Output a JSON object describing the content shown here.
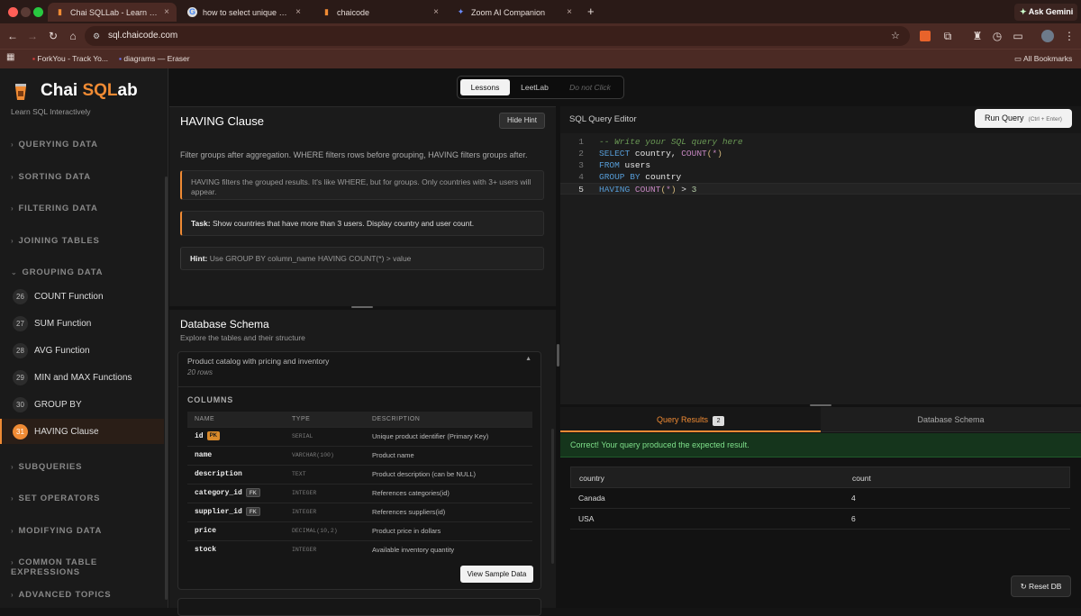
{
  "browser": {
    "tabs": [
      {
        "title": "Chai SQLLab - Learn SQL Interactively",
        "icon": "chai-cup-icon",
        "active": true
      },
      {
        "title": "how to select unique values in",
        "icon": "google-icon",
        "active": false
      },
      {
        "title": "chaicode",
        "icon": "chai-cup-icon",
        "active": false
      },
      {
        "title": "Zoom AI Companion",
        "icon": "sparkle-icon",
        "active": false
      }
    ],
    "new_tab": "+",
    "ask_gemini": "Ask Gemini",
    "url": "sql.chaicode.com",
    "bookmarks": [
      "ForkYou - Track Yo...",
      "diagrams — Eraser"
    ],
    "all_bookmarks": "All Bookmarks"
  },
  "sidebar": {
    "logo_a": "Chai ",
    "logo_b": "SQL",
    "logo_c": "ab",
    "tagline": "Learn SQL Interactively",
    "sections": [
      "QUERYING DATA",
      "SORTING DATA",
      "FILTERING DATA",
      "JOINING TABLES",
      "GROUPING DATA",
      "SUBQUERIES",
      "SET OPERATORS",
      "MODIFYING DATA",
      "COMMON TABLE EXPRESSIONS",
      "ADVANCED TOPICS"
    ],
    "lessons": [
      {
        "num": "26",
        "label": "COUNT Function"
      },
      {
        "num": "27",
        "label": "SUM Function"
      },
      {
        "num": "28",
        "label": "AVG Function"
      },
      {
        "num": "29",
        "label": "MIN and MAX Functions"
      },
      {
        "num": "30",
        "label": "GROUP BY"
      },
      {
        "num": "31",
        "label": "HAVING Clause"
      }
    ]
  },
  "mode_switch": {
    "lessons": "Lessons",
    "leetlab": "LeetLab",
    "donot": "Do not Click"
  },
  "lesson": {
    "title": "HAVING Clause",
    "hide_hint": "Hide Hint",
    "description": "Filter groups after aggregation. WHERE filters rows before grouping, HAVING filters groups after.",
    "note": "HAVING filters the grouped results. It's like WHERE, but for groups. Only countries with 3+ users will appear.",
    "task_label": "Task:",
    "task": "Show countries that have more than 3 users. Display country and user count.",
    "hint_label": "Hint:",
    "hint": "Use GROUP BY column_name HAVING COUNT(*) > value"
  },
  "schema": {
    "title": "Database Schema",
    "subtitle": "Explore the tables and their structure",
    "table_desc": "Product catalog with pricing and inventory",
    "rows": "20 rows",
    "columns_label": "COLUMNS",
    "headers": {
      "name": "NAME",
      "type": "TYPE",
      "desc": "DESCRIPTION"
    },
    "columns": [
      {
        "name": "id",
        "badge": "PK",
        "type": "SERIAL",
        "desc": "Unique product identifier (Primary Key)"
      },
      {
        "name": "name",
        "badge": "",
        "type": "VARCHAR(100)",
        "desc": "Product name"
      },
      {
        "name": "description",
        "badge": "",
        "type": "TEXT",
        "desc": "Product description (can be NULL)"
      },
      {
        "name": "category_id",
        "badge": "FK",
        "type": "INTEGER",
        "desc": "References categories(id)"
      },
      {
        "name": "supplier_id",
        "badge": "FK",
        "type": "INTEGER",
        "desc": "References suppliers(id)"
      },
      {
        "name": "price",
        "badge": "",
        "type": "DECIMAL(10,2)",
        "desc": "Product price in dollars"
      },
      {
        "name": "stock",
        "badge": "",
        "type": "INTEGER",
        "desc": "Available inventory quantity"
      }
    ],
    "view_sample": "View Sample Data"
  },
  "editor": {
    "title": "SQL Query Editor",
    "run": "Run Query",
    "shortcut": "(Ctrl + Enter)",
    "lines": [
      {
        "num": "1",
        "tokens": [
          [
            "cm",
            "-- Write your SQL query here"
          ]
        ]
      },
      {
        "num": "2",
        "tokens": [
          [
            "kw",
            "SELECT"
          ],
          [
            "id",
            " country, "
          ],
          [
            "fn",
            "COUNT"
          ],
          [
            "pn",
            "("
          ],
          [
            "fn",
            "*"
          ],
          [
            "pn",
            ")"
          ]
        ]
      },
      {
        "num": "3",
        "tokens": [
          [
            "kw",
            "FROM"
          ],
          [
            "id",
            " users"
          ]
        ]
      },
      {
        "num": "4",
        "tokens": [
          [
            "kw",
            "GROUP BY"
          ],
          [
            "id",
            " country"
          ]
        ]
      },
      {
        "num": "5",
        "tokens": [
          [
            "kw",
            "HAVING"
          ],
          [
            "id",
            " "
          ],
          [
            "fn",
            "COUNT"
          ],
          [
            "pn",
            "("
          ],
          [
            "fn",
            "*"
          ],
          [
            "pn",
            ")"
          ],
          [
            "id",
            " > "
          ],
          [
            "nm",
            "3"
          ]
        ]
      }
    ]
  },
  "results": {
    "tab_results": "Query Results",
    "count": "2",
    "tab_schema": "Database Schema",
    "success": "Correct! Your query produced the expected result.",
    "headers": [
      "country",
      "count"
    ],
    "rows": [
      [
        "Canada",
        "4"
      ],
      [
        "USA",
        "6"
      ]
    ],
    "reset": "↻ Reset DB"
  }
}
